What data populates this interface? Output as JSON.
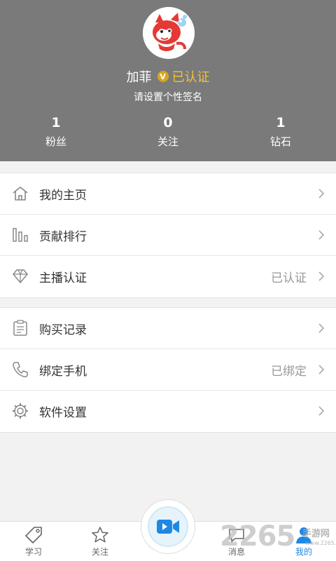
{
  "profile": {
    "name": "加菲",
    "badge_letter": "V",
    "verified_text": "已认证",
    "signature": "请设置个性签名",
    "header_color": "#7a7a7a",
    "stats": [
      {
        "value": "1",
        "label": "粉丝"
      },
      {
        "value": "0",
        "label": "关注"
      },
      {
        "value": "1",
        "label": "钻石"
      }
    ]
  },
  "menu": {
    "group1": [
      {
        "label": "我的主页",
        "value": "",
        "icon": "home-icon"
      },
      {
        "label": "贡献排行",
        "value": "",
        "icon": "ranking-bars-icon"
      },
      {
        "label": "主播认证",
        "value": "已认证",
        "icon": "diamond-icon"
      }
    ],
    "group2": [
      {
        "label": "购买记录",
        "value": "",
        "icon": "clipboard-icon"
      },
      {
        "label": "绑定手机",
        "value": "已绑定",
        "icon": "phone-icon"
      },
      {
        "label": "软件设置",
        "value": "",
        "icon": "gear-icon"
      }
    ]
  },
  "tabbar": {
    "tabs": [
      {
        "label": "学习",
        "icon": "tag-icon"
      },
      {
        "label": "关注",
        "icon": "star-icon"
      },
      {
        "label": "消息",
        "icon": "chat-icon"
      },
      {
        "label": "我的",
        "icon": "person-icon",
        "active": true
      }
    ],
    "center_icon": "video-camera-icon",
    "accent_color": "#1e88e5"
  },
  "watermark": {
    "number": "2265",
    "text": "手游网",
    "url": "www.2265.com"
  }
}
